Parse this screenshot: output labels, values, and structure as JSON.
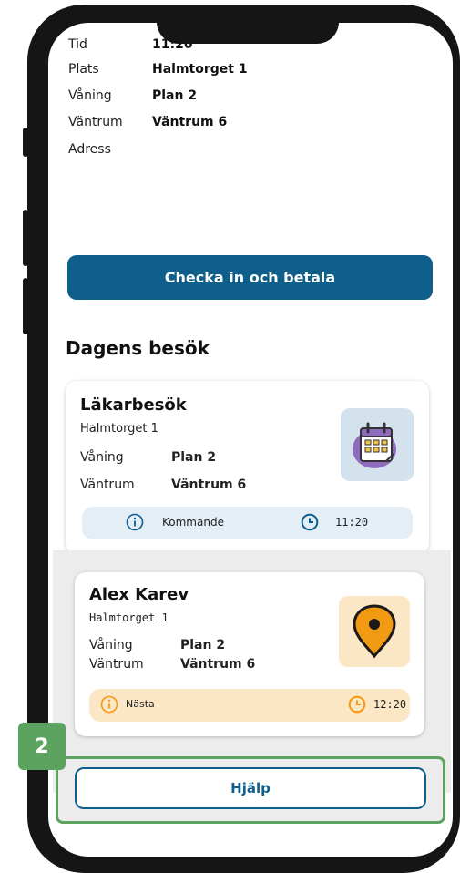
{
  "details": {
    "tid_label": "Tid",
    "tid_value": "11:20",
    "plats_label": "Plats",
    "plats_value": "Halmtorget 1",
    "vaning_label": "Våning",
    "vaning_value": "Plan 2",
    "vantrum_label": "Väntrum",
    "vantrum_value": "Väntrum 6",
    "adress_label": "Adress"
  },
  "checkin_button": "Checka in och betala",
  "section_title": "Dagens besök",
  "visits": [
    {
      "title": "Läkarbesök",
      "location": "Halmtorget 1",
      "floor_label": "Våning",
      "floor_value": "Plan 2",
      "room_label": "Väntrum",
      "room_value": "Väntrum 6",
      "status": "Kommande",
      "time": "11:20",
      "icon": "calendar-icon"
    },
    {
      "title": "Alex Karev",
      "location": "Halmtorget 1",
      "floor_label": "Våning",
      "floor_value": "Plan 2",
      "room_label": "Väntrum",
      "room_value": "Väntrum 6",
      "status": "Nästa",
      "time": "12:20",
      "icon": "location-pin-icon"
    }
  ],
  "help_button": "Hjälp",
  "step_badge": "2",
  "colors": {
    "primary": "#0f5f8d",
    "highlight": "#5ba35e",
    "upcoming_bg": "#e3eef6",
    "next_bg": "#fbe6c6",
    "accent_orange": "#f29a12"
  }
}
